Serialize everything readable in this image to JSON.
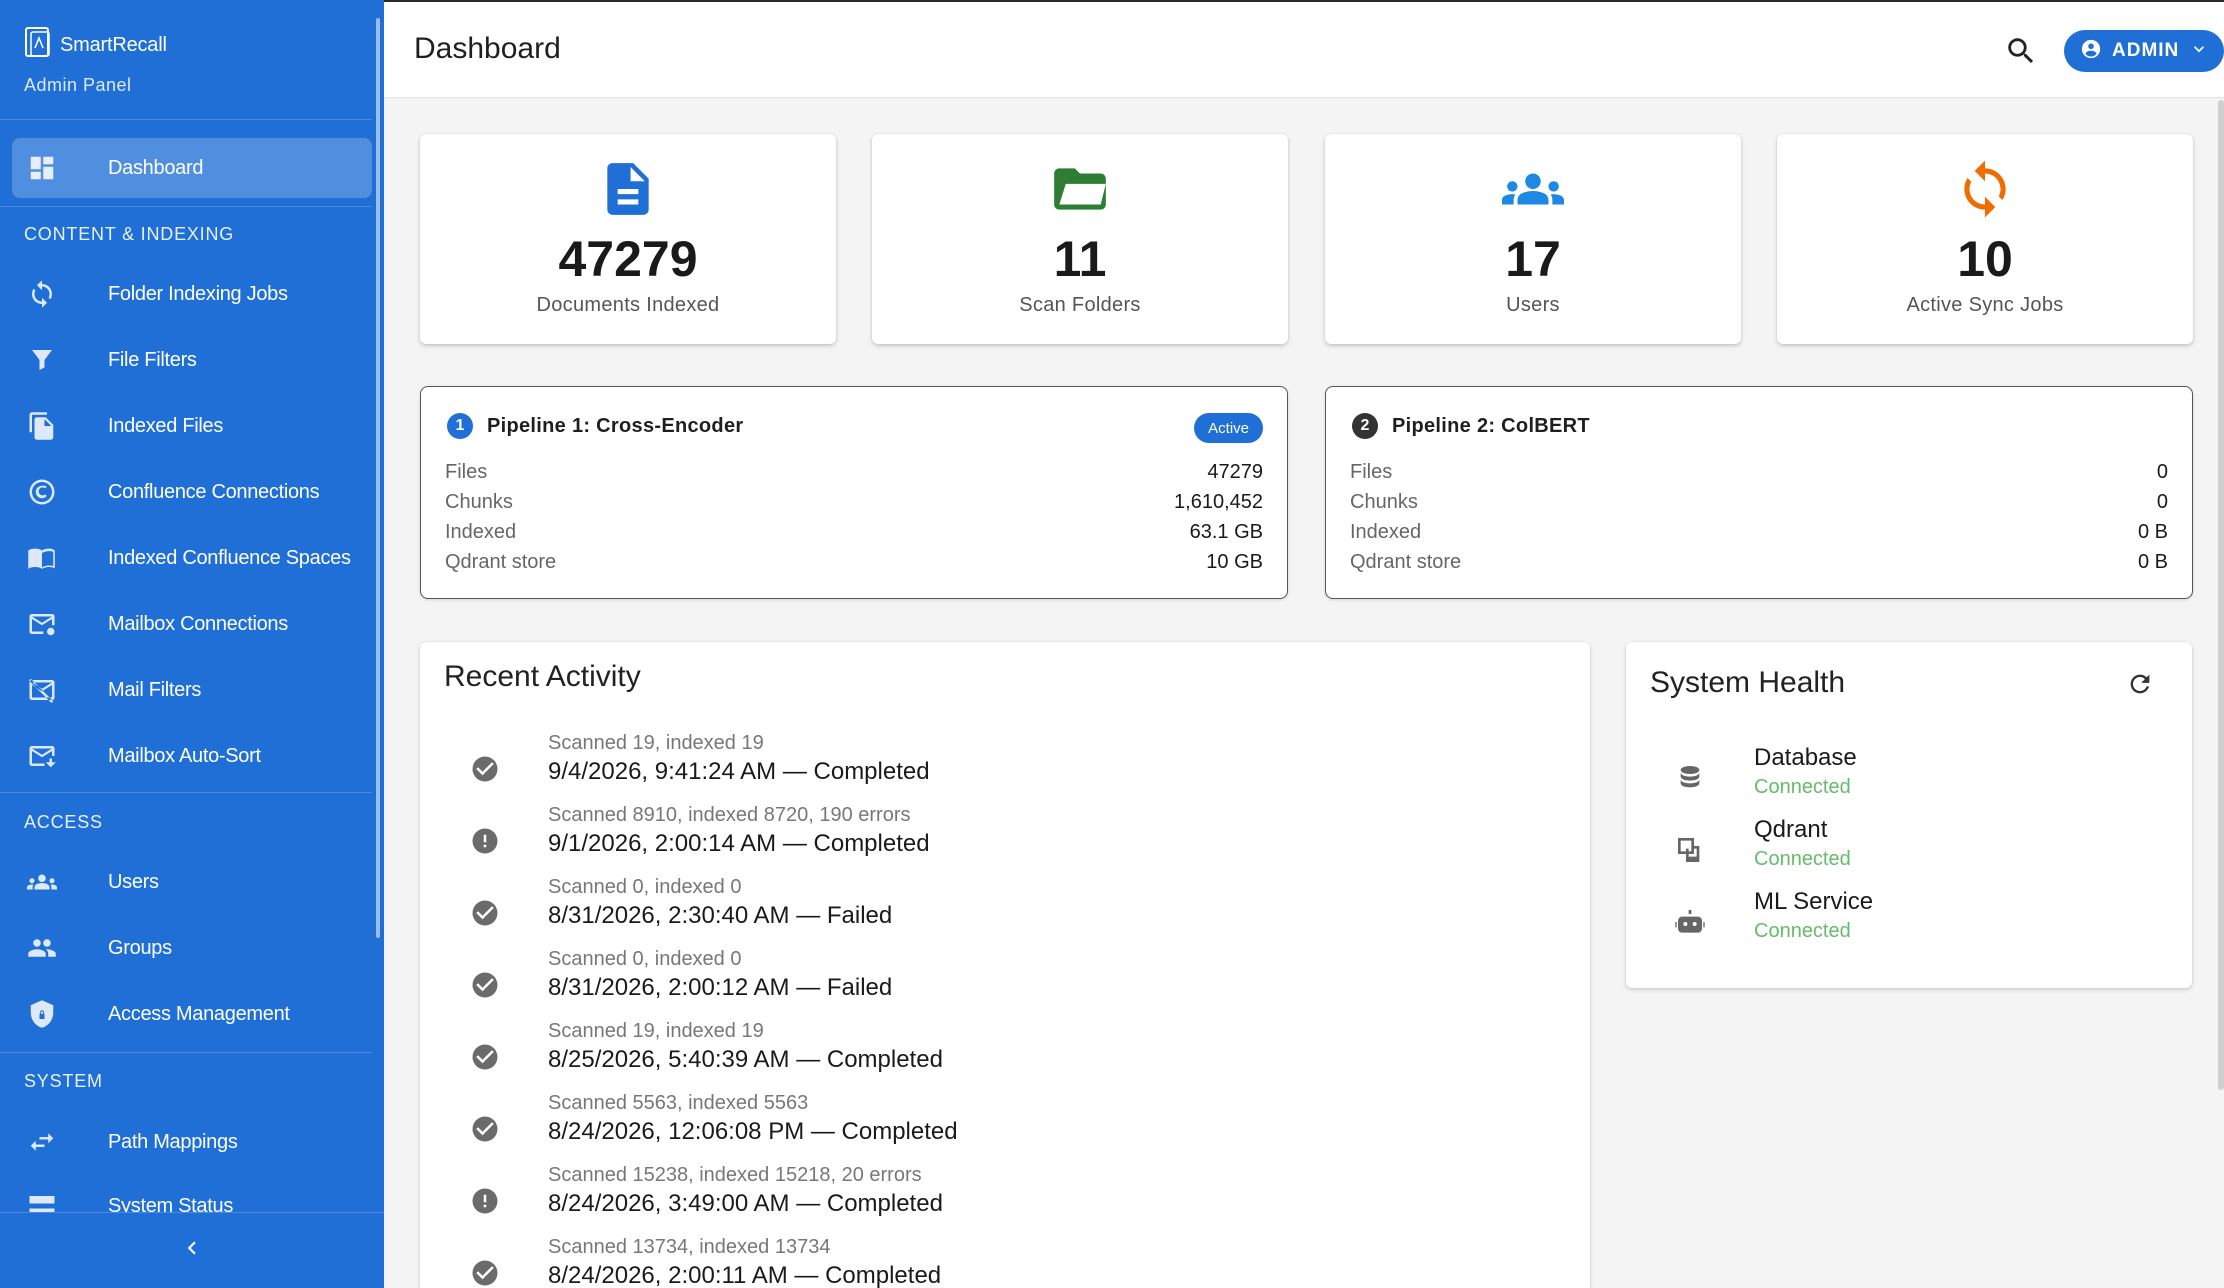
{
  "app": {
    "name": "SmartRecall",
    "subtitle": "Admin Panel"
  },
  "sidebar": {
    "active": "Dashboard",
    "items": [
      {
        "label": "Dashboard",
        "icon": "dashboard-icon"
      },
      {
        "section": "CONTENT & INDEXING"
      },
      {
        "label": "Folder Indexing Jobs",
        "icon": "sync-icon"
      },
      {
        "label": "File Filters",
        "icon": "filter-icon"
      },
      {
        "label": "Indexed Files",
        "icon": "file-copy-icon"
      },
      {
        "label": "Confluence Connections",
        "icon": "confluence-icon"
      },
      {
        "label": "Indexed Confluence Spaces",
        "icon": "book-icon"
      },
      {
        "label": "Mailbox Connections",
        "icon": "mail-settings-icon"
      },
      {
        "label": "Mail Filters",
        "icon": "mail-filter-icon"
      },
      {
        "label": "Mailbox Auto-Sort",
        "icon": "mail-sort-icon"
      },
      {
        "section": "ACCESS"
      },
      {
        "label": "Users",
        "icon": "users-icon"
      },
      {
        "label": "Groups",
        "icon": "groups-icon"
      },
      {
        "label": "Access Management",
        "icon": "shield-icon"
      },
      {
        "section": "SYSTEM"
      },
      {
        "label": "Path Mappings",
        "icon": "swap-icon"
      },
      {
        "label": "System Status",
        "icon": "server-icon"
      }
    ],
    "collapse_icon": "chevron-left-icon"
  },
  "header": {
    "title": "Dashboard",
    "search_icon": "search-icon",
    "user_label": "ADMIN"
  },
  "stats": [
    {
      "value": "47279",
      "label": "Documents Indexed",
      "icon": "document-icon",
      "color": "#1f6fd6"
    },
    {
      "value": "11",
      "label": "Scan Folders",
      "icon": "folder-open-icon",
      "color": "#2e7d32"
    },
    {
      "value": "17",
      "label": "Users",
      "icon": "people-icon",
      "color": "#1e88e5"
    },
    {
      "value": "10",
      "label": "Active Sync Jobs",
      "icon": "sync-icon",
      "color": "#ef6c00"
    }
  ],
  "pipelines": [
    {
      "number": "1",
      "title": "Pipeline 1: Cross-Encoder",
      "badge": "Active",
      "rows": [
        {
          "key": "Files",
          "value": "47279"
        },
        {
          "key": "Chunks",
          "value": "1,610,452"
        },
        {
          "key": "Indexed",
          "value": "63.1 GB"
        },
        {
          "key": "Qdrant store",
          "value": "10 GB"
        }
      ]
    },
    {
      "number": "2",
      "title": "Pipeline 2: ColBERT",
      "badge": "",
      "rows": [
        {
          "key": "Files",
          "value": "0"
        },
        {
          "key": "Chunks",
          "value": "0"
        },
        {
          "key": "Indexed",
          "value": "0 B"
        },
        {
          "key": "Qdrant store",
          "value": "0 B"
        }
      ]
    }
  ],
  "recent_activity": {
    "title": "Recent Activity",
    "items": [
      {
        "sub": "Scanned 19, indexed 19",
        "main": "9/4/2026, 9:41:24 AM — Completed",
        "icon": "check-circle-icon"
      },
      {
        "sub": "Scanned 8910, indexed 8720, 190 errors",
        "main": "9/1/2026, 2:00:14 AM — Completed",
        "icon": "error-circle-icon"
      },
      {
        "sub": "Scanned 0, indexed 0",
        "main": "8/31/2026, 2:30:40 AM — Failed",
        "icon": "check-circle-icon"
      },
      {
        "sub": "Scanned 0, indexed 0",
        "main": "8/31/2026, 2:00:12 AM — Failed",
        "icon": "check-circle-icon"
      },
      {
        "sub": "Scanned 19, indexed 19",
        "main": "8/25/2026, 5:40:39 AM — Completed",
        "icon": "check-circle-icon"
      },
      {
        "sub": "Scanned 5563, indexed 5563",
        "main": "8/24/2026, 12:06:08 PM — Completed",
        "icon": "check-circle-icon"
      },
      {
        "sub": "Scanned 15238, indexed 15218, 20 errors",
        "main": "8/24/2026, 3:49:00 AM — Completed",
        "icon": "error-circle-icon"
      },
      {
        "sub": "Scanned 13734, indexed 13734",
        "main": "8/24/2026, 2:00:11 AM — Completed",
        "icon": "check-circle-icon"
      }
    ]
  },
  "system_health": {
    "title": "System Health",
    "refresh_icon": "refresh-icon",
    "items": [
      {
        "name": "Database",
        "status": "Connected",
        "icon": "database-icon"
      },
      {
        "name": "Qdrant",
        "status": "Connected",
        "icon": "layers-icon"
      },
      {
        "name": "ML Service",
        "status": "Connected",
        "icon": "robot-icon"
      }
    ]
  }
}
